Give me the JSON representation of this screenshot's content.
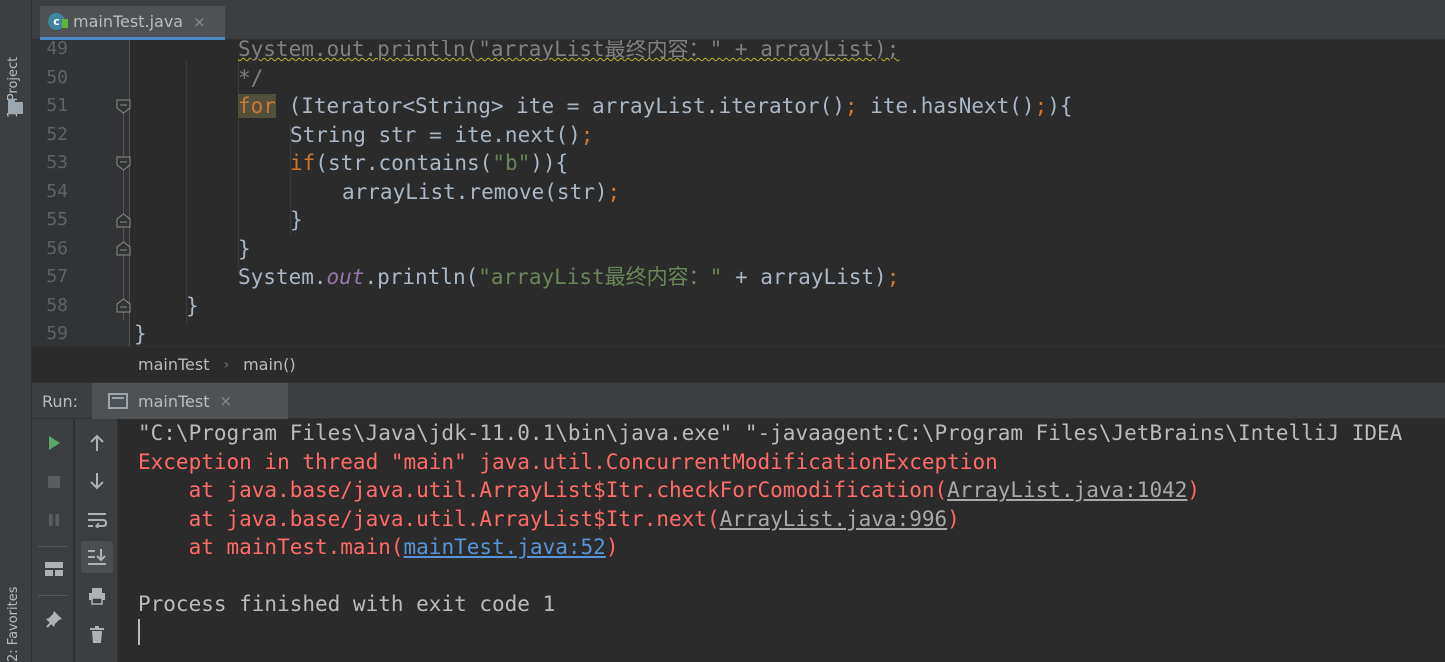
{
  "side_tabs": {
    "project": "1: Project",
    "favorites": "2: Favorites"
  },
  "editor_tab": {
    "title": "mainTest.java",
    "close": "×",
    "icon_letter": "c"
  },
  "line_numbers": [
    "49",
    "50",
    "51",
    "52",
    "53",
    "54",
    "55",
    "56",
    "57",
    "58",
    "59"
  ],
  "code": {
    "l49": "System.out.println(\"arrayList最终内容：\" + arrayList);",
    "l50": "*/",
    "l51": {
      "kw": "for",
      "rest1": " (Iterator<String> ite = arrayList.iterator()",
      "sem1": ";",
      "rest2": " ite.hasNext()",
      "sem2": ";",
      "rest3": "){"
    },
    "l52": {
      "a": "String str = ite.next()",
      "semi": ";"
    },
    "l53": {
      "kw": "if",
      "a": "(str.contains(",
      "s": "\"b\"",
      "b": ")){"
    },
    "l54": {
      "a": "arrayList.remove(str)",
      "semi": ";"
    },
    "l55": "}",
    "l56": "}",
    "l57": {
      "a": "System.",
      "fld": "out",
      "b": ".println(",
      "s": "\"arrayList最终内容：\"",
      "c": " + arrayList)",
      "semi": ";"
    },
    "l58": "}",
    "l59": "}"
  },
  "breadcrumbs": {
    "class": "mainTest",
    "separator": "›",
    "method": "main()"
  },
  "run_window": {
    "label": "Run:",
    "tab_title": "mainTest",
    "tab_close": "×"
  },
  "console": {
    "cmd": "\"C:\\Program Files\\Java\\jdk-11.0.1\\bin\\java.exe\" \"-javaagent:C:\\Program Files\\JetBrains\\IntelliJ IDEA",
    "exception": "Exception in thread \"main\" java.util.ConcurrentModificationException",
    "trace": [
      {
        "prefix": "    at java.base/java.util.ArrayList$Itr.checkForComodification(",
        "link": "ArrayList.java:1042",
        "suffix": ")"
      },
      {
        "prefix": "    at java.base/java.util.ArrayList$Itr.next(",
        "link": "ArrayList.java:996",
        "suffix": ")"
      },
      {
        "prefix": "    at mainTest.main(",
        "link": "mainTest.java:52",
        "suffix": ")"
      }
    ],
    "finished": "Process finished with exit code 1"
  },
  "colors": {
    "background": "#2b2b2b",
    "panel": "#3c3f41",
    "keyword": "#cc7832",
    "string": "#6a8759",
    "error": "#ff6b68",
    "link": "#5894d8",
    "run_green": "#59a869"
  }
}
